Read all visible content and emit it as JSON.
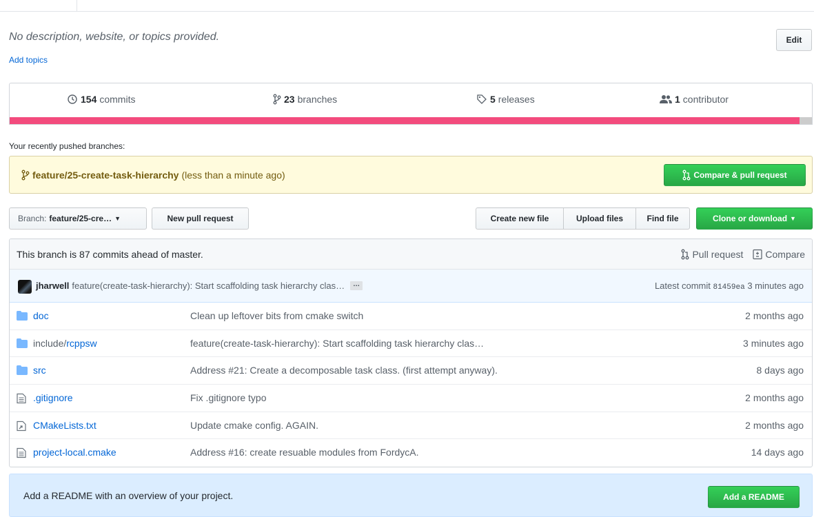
{
  "repo": {
    "description": "No description, website, or topics provided.",
    "add_topics": "Add topics",
    "edit_label": "Edit"
  },
  "summary": {
    "commits_count": "154",
    "commits_label": "commits",
    "branches_count": "23",
    "branches_label": "branches",
    "releases_count": "5",
    "releases_label": "releases",
    "contributors_count": "1",
    "contributors_label": "contributor",
    "language_color": "#f34b7d"
  },
  "recent": {
    "label": "Your recently pushed branches:",
    "branch": "feature/25-create-task-hierarchy",
    "time": "(less than a minute ago)",
    "compare_label": "Compare & pull request"
  },
  "toolbar": {
    "branch_prefix": "Branch:",
    "branch_name": "feature/25-cre…",
    "new_pr": "New pull request",
    "create_file": "Create new file",
    "upload_files": "Upload files",
    "find_file": "Find file",
    "clone": "Clone or download"
  },
  "ahead": {
    "text": "This branch is 87 commits ahead of master.",
    "pull_request": "Pull request",
    "compare": "Compare"
  },
  "commit": {
    "author": "jharwell",
    "message": "feature(create-task-hierarchy): Start scaffolding task hierarchy clas…",
    "ellipsis": "…",
    "latest_label": "Latest commit",
    "sha": "81459ea",
    "time": "3 minutes ago"
  },
  "files": [
    {
      "type": "dir",
      "prefix": "",
      "name": "doc",
      "message": "Clean up leftover bits from cmake switch",
      "age": "2 months ago"
    },
    {
      "type": "dir",
      "prefix": "include/",
      "name": "rcppsw",
      "message": "feature(create-task-hierarchy): Start scaffolding task hierarchy clas…",
      "age": "3 minutes ago"
    },
    {
      "type": "dir",
      "prefix": "",
      "name": "src",
      "message": "Address #21: Create a decomposable task class. (first attempt anyway).",
      "age": "8 days ago"
    },
    {
      "type": "file",
      "prefix": "",
      "name": ".gitignore",
      "message": "Fix .gitignore typo",
      "age": "2 months ago"
    },
    {
      "type": "symlink",
      "prefix": "",
      "name": "CMakeLists.txt",
      "message": "Update cmake config. AGAIN.",
      "age": "2 months ago"
    },
    {
      "type": "file",
      "prefix": "",
      "name": "project-local.cmake",
      "message": "Address #16: create resuable modules from FordycA.",
      "age": "14 days ago"
    }
  ],
  "readme": {
    "text": "Add a README with an overview of your project.",
    "button": "Add a README"
  }
}
